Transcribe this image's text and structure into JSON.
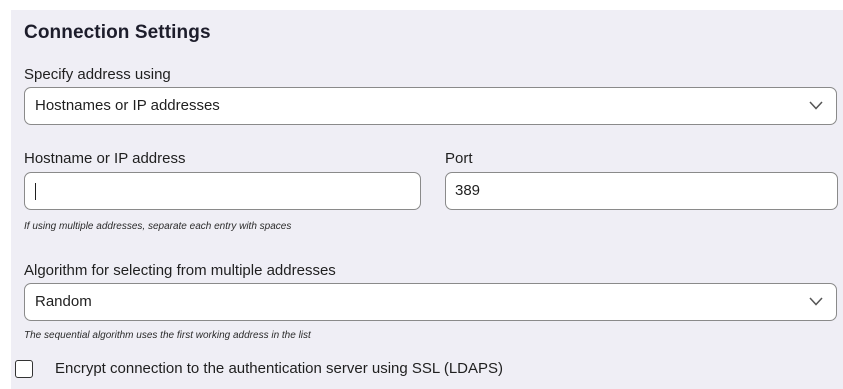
{
  "connection_settings": {
    "title": "Connection Settings",
    "address_mode": {
      "label": "Specify address using",
      "selected": "Hostnames or IP addresses",
      "icon": "chevron-down-icon"
    },
    "hostname": {
      "label": "Hostname or IP address",
      "value": "",
      "hint": "If using multiple addresses, separate each entry with spaces"
    },
    "port": {
      "label": "Port",
      "value": "389"
    },
    "algorithm": {
      "label": "Algorithm for selecting from multiple addresses",
      "selected": "Random",
      "icon": "chevron-down-icon",
      "hint": "The sequential algorithm uses the first working address in the list"
    },
    "ssl": {
      "label": "Encrypt connection to the authentication server using SSL (LDAPS)",
      "checked": false
    }
  },
  "colors": {
    "panel_background": "#efeef5",
    "field_background": "#ffffff",
    "field_border": "#8a8a8a",
    "text": "#1f1f1f"
  }
}
